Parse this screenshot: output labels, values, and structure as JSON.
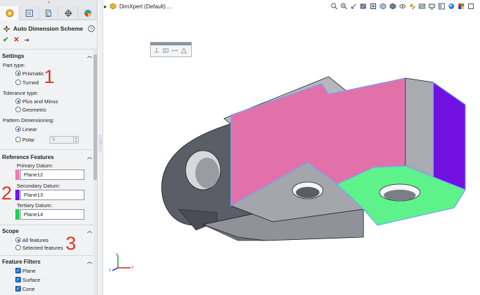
{
  "panel": {
    "collapse_glyph": "«",
    "tabs": [
      {
        "icon": "feature-manager-icon",
        "active": true
      },
      {
        "icon": "property-manager-icon",
        "active": false
      },
      {
        "icon": "configuration-manager-icon",
        "active": false
      },
      {
        "icon": "dimxpert-manager-icon",
        "active": false
      },
      {
        "icon": "display-manager-icon",
        "active": false
      }
    ],
    "title": "Auto Dimension Scheme",
    "help_glyph": "?",
    "ok_glyph": "✔",
    "cancel_glyph": "✕",
    "pin_glyph": "⇥"
  },
  "settings": {
    "heading": "Settings",
    "part_type_label": "Part type:",
    "part_type_options": [
      "Prismatic",
      "Turned"
    ],
    "part_type_selected": "Prismatic",
    "tolerance_label": "Tolerance type:",
    "tolerance_options": [
      "Plus and Minus",
      "Geometric"
    ],
    "tolerance_selected": "Plus and Minus",
    "pattern_label": "Pattern Dimensioning:",
    "pattern_options": [
      "Linear",
      "Polar"
    ],
    "pattern_selected": "Linear",
    "polar_count": "5"
  },
  "reference": {
    "heading": "Reference Features",
    "primary_label": "Primary Datum:",
    "primary_value": "Plane12",
    "primary_color": "#f07ab0",
    "secondary_label": "Secondary Datum:",
    "secondary_value": "Plane13",
    "secondary_color": "#7a12e6",
    "tertiary_label": "Tertiary Datum:",
    "tertiary_value": "Plane14",
    "tertiary_color": "#18d64a"
  },
  "scope": {
    "heading": "Scope",
    "options": [
      "All features",
      "Selected features"
    ],
    "selected": "All features"
  },
  "filters": {
    "heading": "Feature Filters",
    "items": [
      "Plane",
      "Surface",
      "Cone"
    ]
  },
  "callouts": [
    "1",
    "2",
    "3"
  ],
  "viewport": {
    "breadcrumb_arrow": "▸",
    "breadcrumb": "DimXpert  (Default) ...",
    "face_colors": {
      "primary": "#e371a9",
      "secondary": "#7210e2",
      "tertiary": "#5ef28a",
      "body_light": "#a9abb1",
      "body_mid": "#8d9097",
      "body_dark": "#5d6068",
      "edge_highlight": "#6aa8ff"
    },
    "triad_labels": {
      "x": "X",
      "y": "Y",
      "z": "Z"
    }
  }
}
